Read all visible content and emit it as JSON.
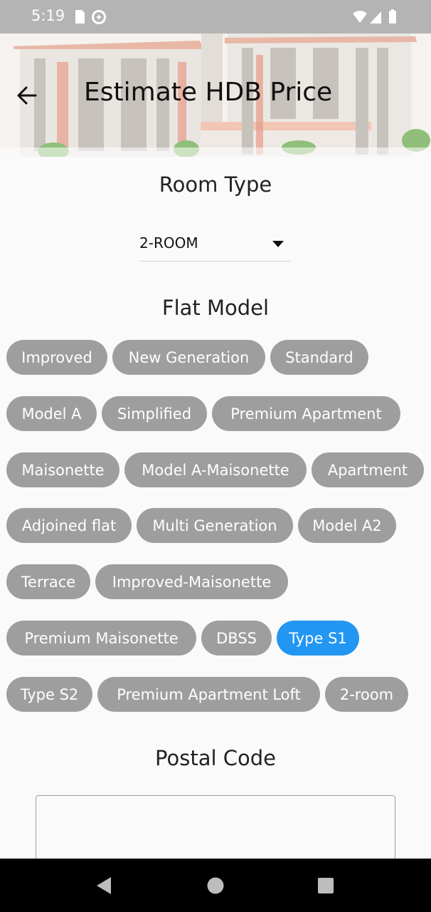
{
  "status_bar": {
    "time": "5:19",
    "left_icons": [
      "sd-card-icon",
      "data-saver-icon"
    ],
    "right_icons": [
      "wifi-icon",
      "signal-icon",
      "battery-icon"
    ]
  },
  "header": {
    "title": "Estimate HDB Price",
    "back_icon": "arrow-left-icon"
  },
  "room_type": {
    "label": "Room Type",
    "selected": "2-ROOM"
  },
  "flat_model": {
    "label": "Flat Model",
    "selected": "Type S1",
    "selected_color": "#2196f3",
    "chip_color": "#9e9e9e",
    "rows": [
      [
        "Improved",
        "New Generation",
        "Standard"
      ],
      [
        "Model A",
        "Simplified",
        "Premium Apartment"
      ],
      [
        "Maisonette",
        "Model A-Maisonette",
        "Apartment"
      ],
      [
        "Adjoined flat",
        "Multi Generation",
        "Model A2"
      ],
      [
        "Terrace",
        "Improved-Maisonette"
      ],
      [
        "Premium Maisonette",
        "DBSS",
        "Type S1"
      ],
      [
        "Type S2",
        "Premium Apartment Loft",
        "2-room"
      ]
    ]
  },
  "postal_code": {
    "label": "Postal Code",
    "value": ""
  },
  "nav_bar": {
    "buttons": [
      "back-triangle-icon",
      "home-circle-icon",
      "recents-square-icon"
    ]
  }
}
